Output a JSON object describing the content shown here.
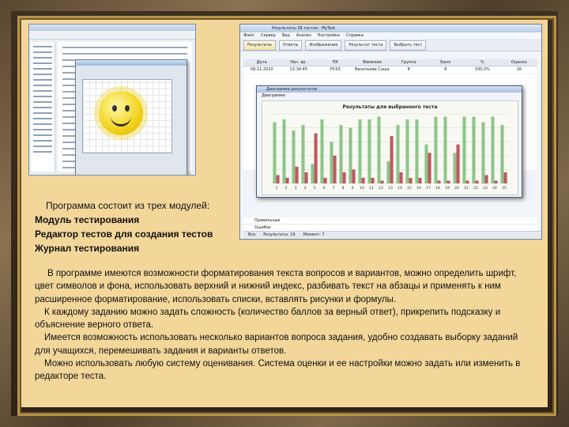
{
  "intro": "Программа состоит из трех модулей:",
  "modules": [
    "Модуль тестирования",
    "Редактор тестов для создания тестов",
    "Журнал тестирования"
  ],
  "paragraphs": [
    "В программе имеются возможности форматирования текста вопросов и вариантов, можно определить шрифт, цвет символов и фона, использовать верхний и нижний индекс, разбивать текст на абзацы и применять к ним расширенное форматирование, использовать списки, вставлять рисунки и формулы.",
    "К каждому заданию можно задать сложность (количество баллов за верный ответ), прикрепить подсказку и объяснение верного ответа.",
    "Имеется возможность использовать несколько вариантов вопроса задания, удобно создавать выборку заданий для учащихся, перемешивать задания и варианты ответов.",
    "Можно использовать любую систему оценивания. Система оценки и ее настройки можно задать или изменить в редакторе теста."
  ],
  "journal": {
    "title": "Результаты 38 тестов - MyTest",
    "menu": [
      "Файл",
      "Сервер",
      "Вид",
      "Анализ",
      "Настройка",
      "Справка"
    ],
    "toolbar": [
      "Результаты",
      "Ответы",
      "Изображение",
      "Результат теста",
      "Выбрать тест"
    ],
    "table_headers": [
      "Дата",
      "Нач. вр.",
      "ПК",
      "Фамилия",
      "Группа",
      "Балл",
      "%",
      "Оценка"
    ],
    "first_row": [
      "09.11.2010",
      "13:34:45",
      "PC03",
      "Васильева Саша",
      "8",
      "8",
      "100,0%",
      "10"
    ],
    "chart_window_title": "Диаграмма результатов",
    "chart_tab": "Диаграмма",
    "bottom_rows": [
      "Правильные",
      "Ошибок"
    ],
    "status": [
      "Все",
      "Результаты: 19",
      "Момент: 7"
    ]
  },
  "chart_data": {
    "type": "bar",
    "title": "Результаты для выбранного теста",
    "categories": [
      "1",
      "2",
      "3",
      "4",
      "5",
      "6",
      "7",
      "8",
      "9",
      "10",
      "11",
      "12",
      "13",
      "14",
      "15",
      "16",
      "17",
      "18",
      "19",
      "20",
      "21",
      "22",
      "23",
      "24",
      "25"
    ],
    "series": [
      {
        "name": "",
        "color": "#8fc48a",
        "values": [
          22,
          23,
          19,
          21,
          7,
          23,
          15,
          21,
          20,
          23,
          23,
          24,
          8,
          21,
          23,
          23,
          14,
          24,
          24,
          11,
          24,
          24,
          22,
          24,
          21
        ]
      },
      {
        "name": "",
        "color": "#c0575f",
        "values": [
          3,
          2,
          6,
          4,
          18,
          2,
          10,
          4,
          5,
          2,
          2,
          1,
          17,
          4,
          2,
          2,
          11,
          1,
          1,
          14,
          1,
          1,
          3,
          1,
          4
        ]
      }
    ],
    "ylim": [
      0,
      25
    ],
    "grid": true
  }
}
